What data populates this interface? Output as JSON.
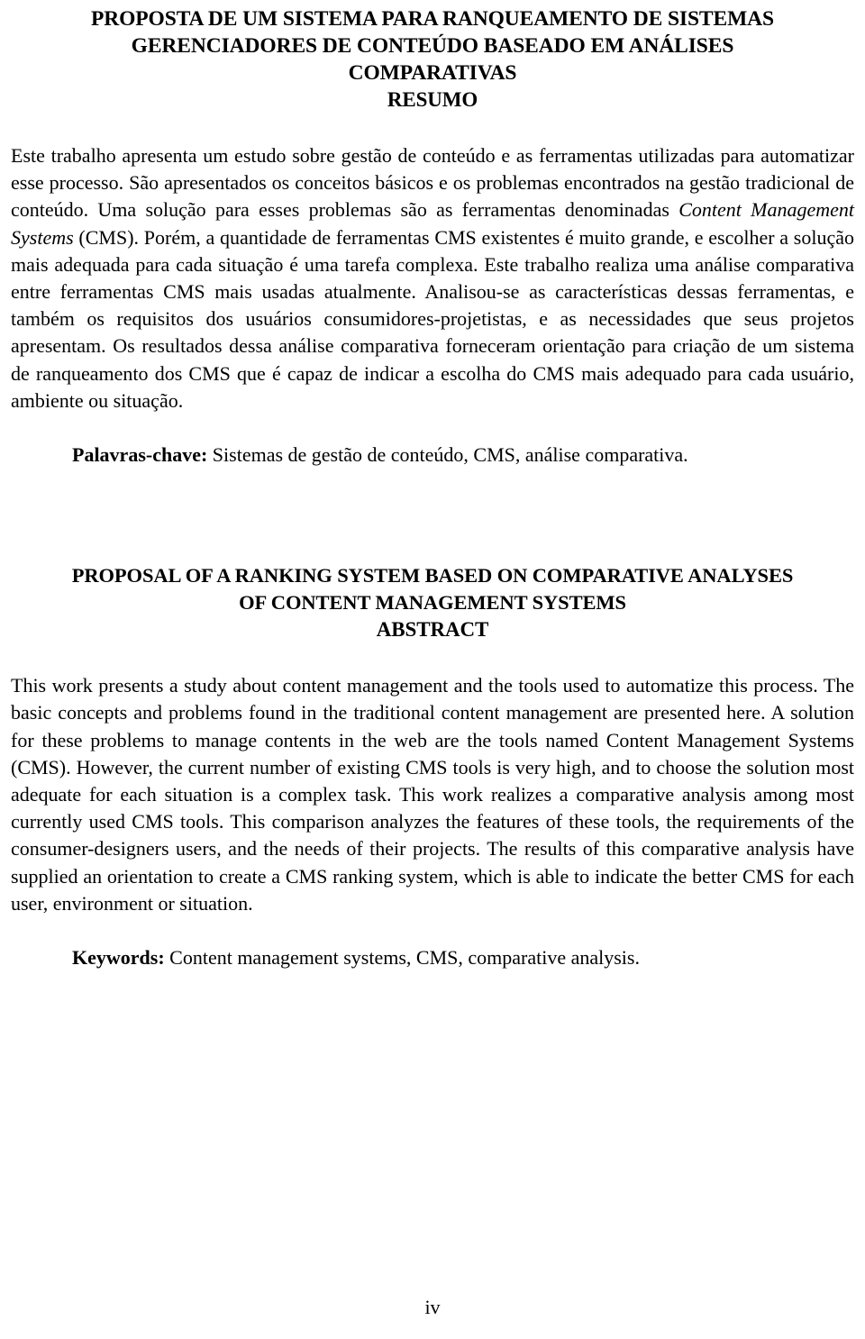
{
  "document": {
    "page_number": "iv"
  },
  "portuguese": {
    "title_lines": [
      "PROPOSTA DE UM SISTEMA PARA RANQUEAMENTO DE SISTEMAS",
      "GERENCIADORES DE CONTEÚDO BASEADO EM ANÁLISES",
      "COMPARATIVAS"
    ],
    "section_heading": "RESUMO",
    "abstract_part_1": "Este trabalho apresenta um estudo sobre gestão de conteúdo e as ferramentas utilizadas para automatizar esse processo. São apresentados os conceitos básicos e os problemas encontrados na gestão tradicional de conteúdo. Uma solução para esses problemas são as ferramentas denominadas ",
    "abstract_italic": "Content Management Systems",
    "abstract_part_2": " (CMS). Porém, a quantidade de ferramentas CMS existentes é muito grande, e escolher a solução mais adequada para cada situação é uma tarefa complexa. Este trabalho realiza uma análise comparativa entre ferramentas CMS mais usadas atualmente. Analisou-se as características dessas ferramentas, e também os requisitos dos usuários consumidores-projetistas, e as necessidades que seus projetos apresentam. Os resultados dessa análise comparativa forneceram orientação para criação de um sistema de ranqueamento dos CMS que é capaz de indicar a escolha do CMS mais adequado para cada usuário, ambiente ou situação.",
    "keywords_label": "Palavras-chave:",
    "keywords_value": " Sistemas de gestão de conteúdo, CMS, análise comparativa."
  },
  "english": {
    "title_lines": [
      "PROPOSAL OF A RANKING SYSTEM BASED ON COMPARATIVE ANALYSES",
      "OF CONTENT MANAGEMENT SYSTEMS"
    ],
    "section_heading": "ABSTRACT",
    "abstract": "This work presents a study about content management and the tools used to automatize this process. The basic concepts and problems found in the traditional content management are presented here. A solution for these problems to manage contents in the web are the tools named Content Management Systems (CMS). However, the current number of existing CMS tools is very high, and to choose the solution most adequate for each situation is a complex task. This work realizes a comparative analysis among most currently used CMS tools. This comparison analyzes the features of these tools, the requirements of the consumer-designers users, and the needs of their projects. The results of this comparative analysis have supplied an orientation to create a CMS ranking system, which is able to indicate the better CMS for each user, environment or situation.",
    "keywords_label": "Keywords:",
    "keywords_value": " Content management systems, CMS, comparative analysis."
  }
}
